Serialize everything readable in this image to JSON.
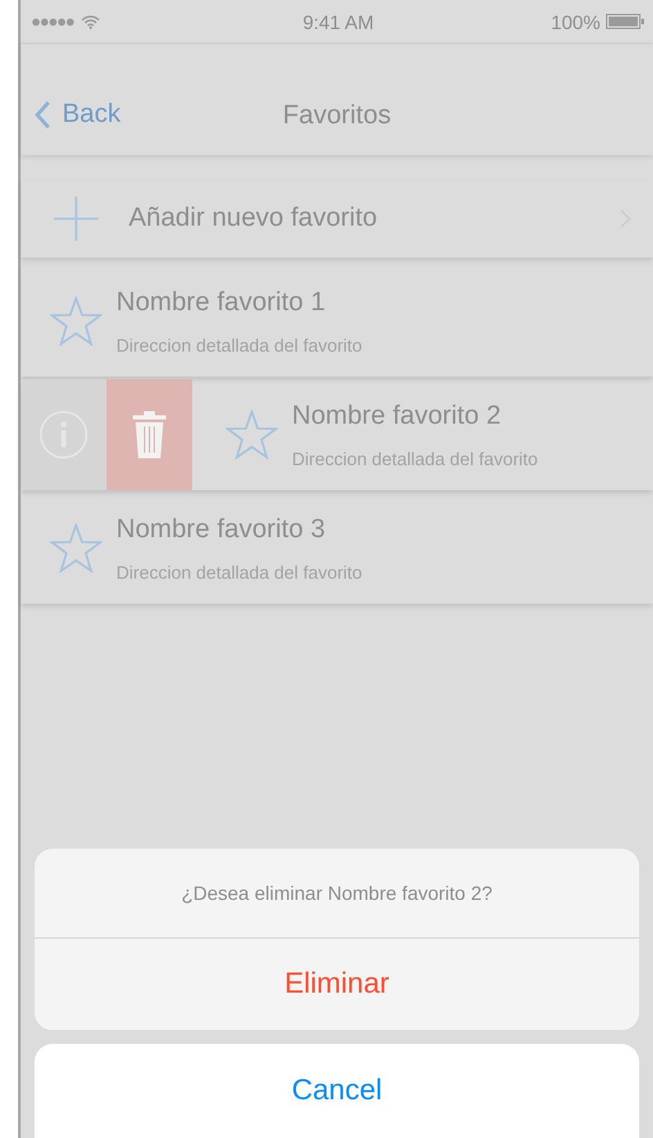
{
  "status_bar": {
    "time": "9:41 AM",
    "battery": "100%"
  },
  "nav": {
    "back": "Back",
    "title": "Favoritos"
  },
  "add_row": {
    "label": "Añadir nuevo favorito"
  },
  "favorites": [
    {
      "name": "Nombre favorito 1",
      "address": "Direccion detallada del favorito",
      "swiped": false
    },
    {
      "name": "Nombre favorito 2",
      "address": "Direccion detallada del favorito",
      "swiped": true
    },
    {
      "name": "Nombre favorito 3",
      "address": "Direccion detallada del favorito",
      "swiped": false
    }
  ],
  "action_sheet": {
    "message": "¿Desea eliminar Nombre favorito 2?",
    "actions": [
      {
        "label": "Eliminar",
        "kind": "destructive"
      }
    ],
    "cancel": "Cancel"
  }
}
